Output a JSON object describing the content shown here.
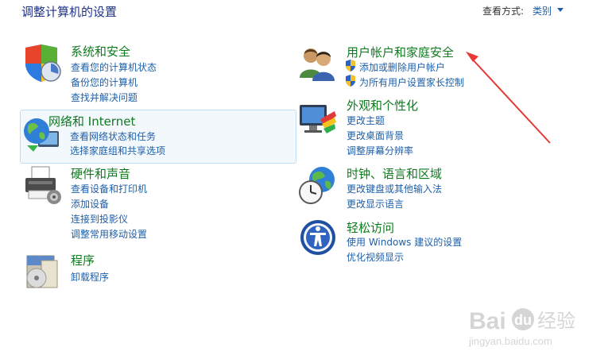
{
  "header": {
    "title": "调整计算机的设置",
    "view_by_label": "查看方式:",
    "view_by_value": "类别"
  },
  "categories": [
    {
      "title": "系统和安全",
      "links": [
        "查看您的计算机状态",
        "备份您的计算机",
        "查找并解决问题"
      ]
    },
    {
      "title": "网络和 Internet",
      "links": [
        "查看网络状态和任务",
        "选择家庭组和共享选项"
      ]
    },
    {
      "title": "硬件和声音",
      "links": [
        "查看设备和打印机",
        "添加设备",
        "连接到投影仪",
        "调整常用移动设置"
      ]
    },
    {
      "title": "程序",
      "links": [
        "卸载程序"
      ]
    },
    {
      "title": "用户帐户和家庭安全",
      "links": [
        "添加或删除用户帐户",
        "为所有用户设置家长控制"
      ]
    },
    {
      "title": "外观和个性化",
      "links": [
        "更改主题",
        "更改桌面背景",
        "调整屏幕分辨率"
      ]
    },
    {
      "title": "时钟、语言和区域",
      "links": [
        "更改键盘或其他输入法",
        "更改显示语言"
      ]
    },
    {
      "title": "轻松访问",
      "links": [
        "使用 Windows 建议的设置",
        "优化视频显示"
      ]
    }
  ],
  "icons": {
    "system_security": "shield-security-icon",
    "network": "globe-network-icon",
    "hardware": "printer-icon",
    "programs": "disc-box-icon",
    "user_accounts": "users-icon",
    "appearance": "monitor-palette-icon",
    "clock": "clock-globe-icon",
    "ease_of_access": "accessibility-icon"
  },
  "colors": {
    "title_blue": "#1e3287",
    "link_blue": "#1e5faa",
    "category_green": "#0e7a1e",
    "annotation_red": "#e53935"
  },
  "watermark": {
    "brand": "Bai",
    "paw": "du",
    "cn": "经验",
    "url": "jingyan.baidu.com"
  }
}
